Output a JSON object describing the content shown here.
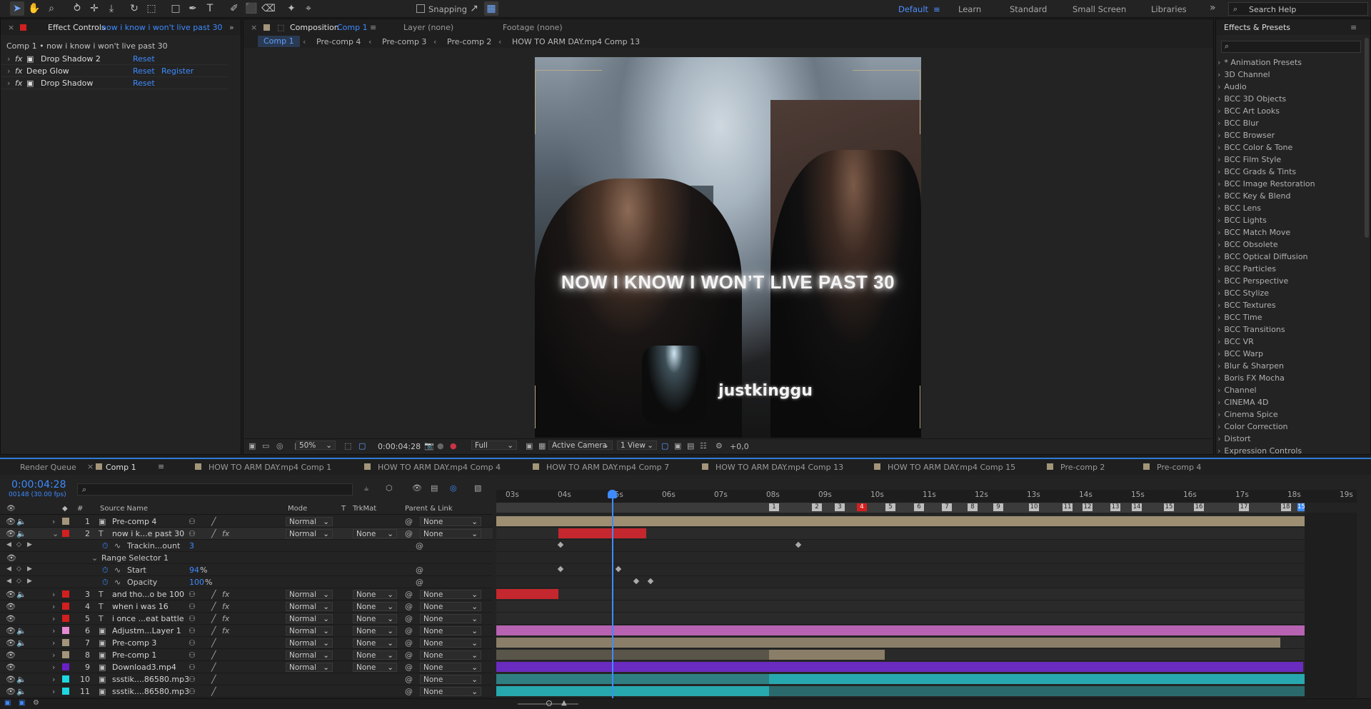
{
  "toolbar": {
    "snapping": "Snapping",
    "workspaces": [
      "Default",
      "Learn",
      "Standard",
      "Small Screen",
      "Libraries"
    ],
    "search_placeholder": "Search Help"
  },
  "effect_controls": {
    "tab_label": "Effect Controls",
    "tab_layer": "now i know i won't live past 30",
    "breadcrumb": "Comp 1 • now i know i won't live past 30",
    "effects": [
      {
        "name": "Drop Shadow 2",
        "reset": "Reset",
        "extra": ""
      },
      {
        "name": "Deep Glow",
        "reset": "Reset",
        "extra": "Register"
      },
      {
        "name": "Drop Shadow",
        "reset": "Reset",
        "extra": ""
      }
    ]
  },
  "composition": {
    "tab_label": "Composition",
    "tab_comp": "Comp 1",
    "layer_tab": "Layer (none)",
    "footage_tab": "Footage (none)",
    "flow": [
      "Comp 1",
      "Pre-comp 4",
      "Pre-comp 3",
      "Pre-comp 2",
      "HOW TO ARM DAY.mp4 Comp 13"
    ],
    "caption": "NOW I KNOW I WON’T LIVE PAST 30",
    "watermark": "justkinggu",
    "zoom": "50%",
    "timecode": "0:00:04:28",
    "resolution": "Full",
    "camera": "Active Camera",
    "views": "1 View",
    "exposure": "+0,0"
  },
  "effects_presets": {
    "title": "Effects & Presets",
    "search_placeholder": "",
    "items": [
      "* Animation Presets",
      "3D Channel",
      "Audio",
      "BCC 3D Objects",
      "BCC Art Looks",
      "BCC Blur",
      "BCC Browser",
      "BCC Color & Tone",
      "BCC Film Style",
      "BCC Grads & Tints",
      "BCC Image Restoration",
      "BCC Key & Blend",
      "BCC Lens",
      "BCC Lights",
      "BCC Match Move",
      "BCC Obsolete",
      "BCC Optical Diffusion",
      "BCC Particles",
      "BCC Perspective",
      "BCC Stylize",
      "BCC Textures",
      "BCC Time",
      "BCC Transitions",
      "BCC VR",
      "BCC Warp",
      "Blur & Sharpen",
      "Boris FX Mocha",
      "Channel",
      "CINEMA 4D",
      "Cinema Spice",
      "Color Correction",
      "Distort",
      "Expression Controls"
    ]
  },
  "timeline": {
    "tabs": [
      "Render Queue",
      "Comp 1",
      "HOW TO ARM DAY.mp4 Comp 1",
      "HOW TO ARM DAY.mp4 Comp 4",
      "HOW TO ARM DAY.mp4 Comp 7",
      "HOW TO ARM DAY.mp4 Comp 13",
      "HOW TO ARM DAY.mp4 Comp 15",
      "Pre-comp 2",
      "Pre-comp 4"
    ],
    "timecode": "0:00:04:28",
    "frame_info": "00148 (30.00 fps)",
    "headers": {
      "hash": "#",
      "source": "Source Name",
      "mode": "Mode",
      "t": "T",
      "trkmat": "TrkMat",
      "parent": "Parent & Link"
    },
    "ruler": [
      "03s",
      "04s",
      "05s",
      "06s",
      "07s",
      "08s",
      "09s",
      "10s",
      "11s",
      "12s",
      "13s",
      "14s",
      "15s",
      "16s",
      "17s",
      "18s",
      "19s"
    ],
    "markers": [
      "1",
      "2",
      "3",
      "4",
      "5",
      "6",
      "7",
      "8",
      "9",
      "10",
      "11",
      "12",
      "13",
      "14",
      "15",
      "16",
      "17",
      "18",
      "15"
    ],
    "layers": [
      {
        "num": "1",
        "name": "Pre-comp 4",
        "color": "#a3957a",
        "mode": "Normal",
        "trkmat": "",
        "parent": "None"
      },
      {
        "num": "2",
        "name": "now i k...e past 30",
        "color": "#d21f1f",
        "mode": "Normal",
        "trkmat": "None",
        "parent": "None"
      },
      {
        "num": "",
        "name": "Trackin...ount",
        "value": "3",
        "unit": ""
      },
      {
        "num": "",
        "name": "Range Selector 1"
      },
      {
        "num": "",
        "name": "Start",
        "value": "94",
        "unit": "%"
      },
      {
        "num": "",
        "name": "Opacity",
        "value": "100",
        "unit": "%"
      },
      {
        "num": "3",
        "name": "and tho...o be 100",
        "color": "#d21f1f",
        "mode": "Normal",
        "trkmat": "None",
        "parent": "None"
      },
      {
        "num": "4",
        "name": "when i was 16",
        "color": "#d21f1f",
        "mode": "Normal",
        "trkmat": "None",
        "parent": "None"
      },
      {
        "num": "5",
        "name": "i once ...eat battle",
        "color": "#d21f1f",
        "mode": "Normal",
        "trkmat": "None",
        "parent": "None"
      },
      {
        "num": "6",
        "name": "Adjustm...Layer 1",
        "color": "#e58ad3",
        "mode": "Normal",
        "trkmat": "None",
        "parent": "None"
      },
      {
        "num": "7",
        "name": "Pre-comp 3",
        "color": "#a3957a",
        "mode": "Normal",
        "trkmat": "None",
        "parent": "None"
      },
      {
        "num": "8",
        "name": "Pre-comp 1",
        "color": "#a3957a",
        "mode": "Normal",
        "trkmat": "None",
        "parent": "None"
      },
      {
        "num": "9",
        "name": "Download3.mp4",
        "color": "#6a1fc7",
        "mode": "Normal",
        "trkmat": "None",
        "parent": "None"
      },
      {
        "num": "10",
        "name": "ssstik....86580.mp3",
        "color": "#1ed7e0",
        "mode": "",
        "trkmat": "",
        "parent": "None"
      },
      {
        "num": "11",
        "name": "ssstik....86580.mp3",
        "color": "#1ed7e0",
        "mode": "",
        "trkmat": "",
        "parent": "None"
      }
    ]
  }
}
